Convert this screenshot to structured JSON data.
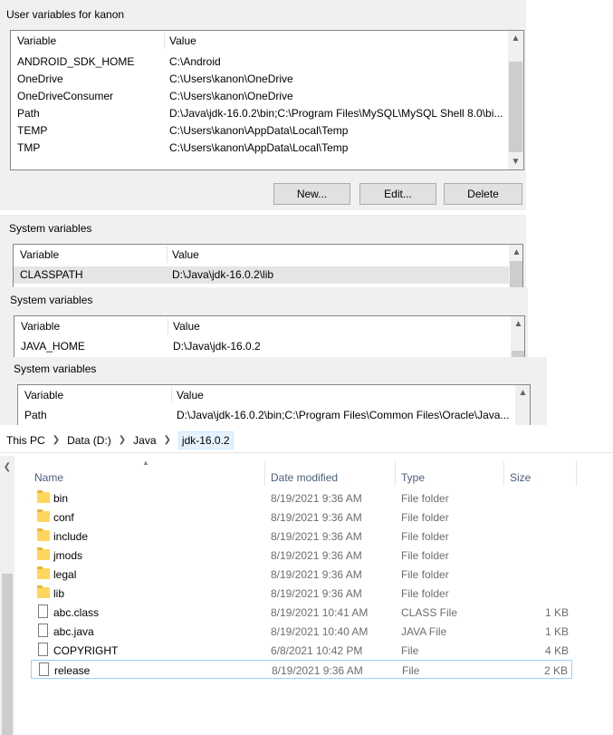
{
  "user_vars": {
    "label": "User variables for kanon",
    "col_variable": "Variable",
    "col_value": "Value",
    "rows": [
      {
        "name": "ANDROID_SDK_HOME",
        "value": "C:\\Android"
      },
      {
        "name": "OneDrive",
        "value": "C:\\Users\\kanon\\OneDrive"
      },
      {
        "name": "OneDriveConsumer",
        "value": "C:\\Users\\kanon\\OneDrive"
      },
      {
        "name": "Path",
        "value": "D:\\Java\\jdk-16.0.2\\bin;C:\\Program Files\\MySQL\\MySQL Shell 8.0\\bi..."
      },
      {
        "name": "TEMP",
        "value": "C:\\Users\\kanon\\AppData\\Local\\Temp"
      },
      {
        "name": "TMP",
        "value": "C:\\Users\\kanon\\AppData\\Local\\Temp"
      }
    ],
    "buttons": {
      "new": "New...",
      "edit": "Edit...",
      "delete": "Delete"
    }
  },
  "sys1": {
    "label": "System variables",
    "col_variable": "Variable",
    "col_value": "Value",
    "row": {
      "name": "CLASSPATH",
      "value": "D:\\Java\\jdk-16.0.2\\lib"
    }
  },
  "sys2": {
    "label": "System variables",
    "col_variable": "Variable",
    "col_value": "Value",
    "row": {
      "name": "JAVA_HOME",
      "value": "D:\\Java\\jdk-16.0.2"
    }
  },
  "sys3": {
    "label": "System variables",
    "col_variable": "Variable",
    "col_value": "Value",
    "row": {
      "name": "Path",
      "value": "D:\\Java\\jdk-16.0.2\\bin;C:\\Program Files\\Common Files\\Oracle\\Java..."
    }
  },
  "explorer": {
    "breadcrumb": [
      "This PC",
      "Data (D:)",
      "Java",
      "jdk-16.0.2"
    ],
    "columns": {
      "name": "Name",
      "date": "Date modified",
      "type": "Type",
      "size": "Size"
    },
    "files": [
      {
        "name": "bin",
        "date": "8/19/2021 9:36 AM",
        "type": "File folder",
        "size": "",
        "icon": "folder-icon"
      },
      {
        "name": "conf",
        "date": "8/19/2021 9:36 AM",
        "type": "File folder",
        "size": "",
        "icon": "folder-icon"
      },
      {
        "name": "include",
        "date": "8/19/2021 9:36 AM",
        "type": "File folder",
        "size": "",
        "icon": "folder-icon"
      },
      {
        "name": "jmods",
        "date": "8/19/2021 9:36 AM",
        "type": "File folder",
        "size": "",
        "icon": "folder-icon"
      },
      {
        "name": "legal",
        "date": "8/19/2021 9:36 AM",
        "type": "File folder",
        "size": "",
        "icon": "folder-icon"
      },
      {
        "name": "lib",
        "date": "8/19/2021 9:36 AM",
        "type": "File folder",
        "size": "",
        "icon": "folder-icon"
      },
      {
        "name": "abc.class",
        "date": "8/19/2021 10:41 AM",
        "type": "CLASS File",
        "size": "1 KB",
        "icon": "file-icon"
      },
      {
        "name": "abc.java",
        "date": "8/19/2021 10:40 AM",
        "type": "JAVA File",
        "size": "1 KB",
        "icon": "file-icon"
      },
      {
        "name": "COPYRIGHT",
        "date": "6/8/2021 10:42 PM",
        "type": "File",
        "size": "4 KB",
        "icon": "file-icon"
      },
      {
        "name": "release",
        "date": "8/19/2021 9:36 AM",
        "type": "File",
        "size": "2 KB",
        "icon": "file-icon"
      }
    ]
  }
}
